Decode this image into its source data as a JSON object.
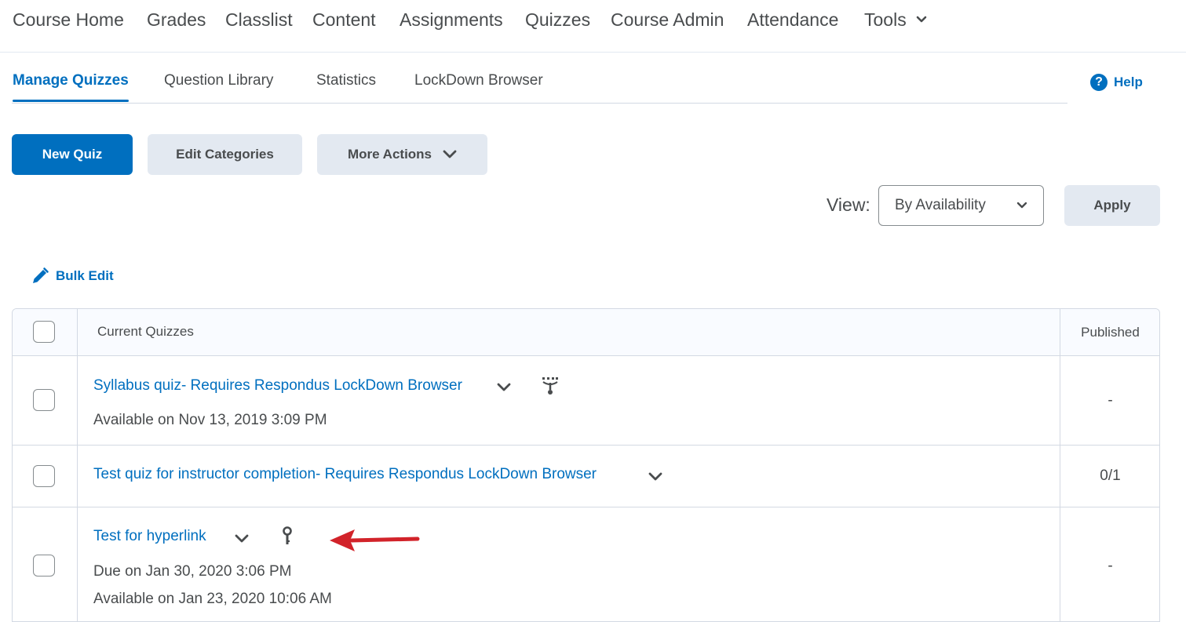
{
  "topnav": {
    "items": [
      "Course Home",
      "Grades",
      "Classlist",
      "Content",
      "Assignments",
      "Quizzes",
      "Course Admin",
      "Attendance",
      "Tools"
    ]
  },
  "subtabs": {
    "items": [
      "Manage Quizzes",
      "Question Library",
      "Statistics",
      "LockDown Browser"
    ],
    "active": "Manage Quizzes"
  },
  "help": {
    "label": "Help",
    "icon": "help-circle-icon"
  },
  "toolbar": {
    "new_quiz": "New Quiz",
    "edit_categories": "Edit Categories",
    "more_actions": "More Actions"
  },
  "view": {
    "label": "View:",
    "selected": "By Availability",
    "apply": "Apply"
  },
  "bulk_edit": {
    "label": "Bulk Edit",
    "icon": "pencil-edit-icon"
  },
  "table": {
    "header": {
      "title": "Current Quizzes",
      "published": "Published"
    },
    "rows": [
      {
        "title": "Syllabus quiz- Requires Respondus LockDown Browser",
        "lines": [
          "Available on Nov 13, 2019 3:09 PM"
        ],
        "published": "-",
        "icon": "release-conditions-icon"
      },
      {
        "title": "Test quiz for instructor completion- Requires Respondus LockDown Browser",
        "lines": [],
        "published": "0/1",
        "icon": ""
      },
      {
        "title": "Test for hyperlink",
        "lines": [
          "Due on Jan 30, 2020 3:06 PM",
          "Available on Jan 23, 2020 10:06 AM"
        ],
        "published": "-",
        "icon": "key-icon"
      }
    ]
  },
  "colors": {
    "primary": "#006fbf",
    "secondary_button": "#e3e9f1",
    "text": "#494c4e",
    "border": "#d3d9e3",
    "annotation_arrow": "#d2232a"
  }
}
